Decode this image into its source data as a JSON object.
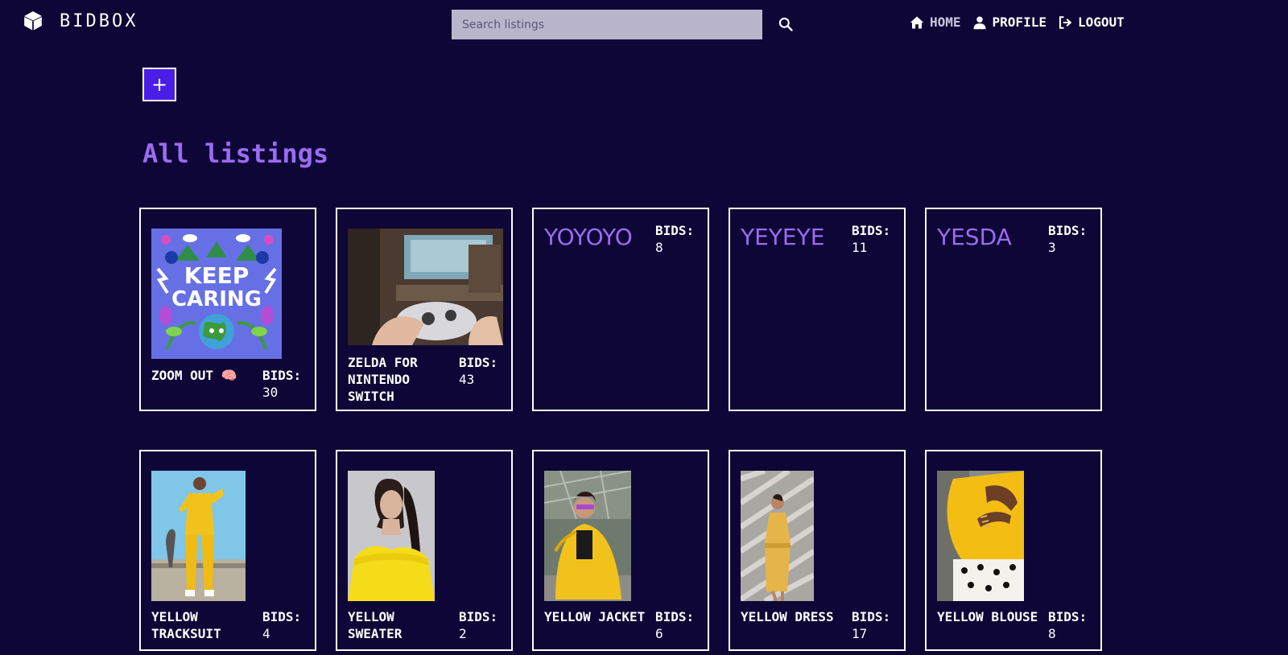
{
  "app": {
    "brand": "BIDBOX"
  },
  "search": {
    "placeholder": "Search listings"
  },
  "nav": {
    "home": "HOME",
    "profile": "PROFILE",
    "logout": "LOGOUT"
  },
  "add_button": {
    "label": "+"
  },
  "heading": "All listings",
  "listings": [
    {
      "title": "ZOOM OUT 🧠",
      "bids_label": "BIDS:",
      "bids": "30"
    },
    {
      "title": "ZELDA FOR NINTENDO SWITCH",
      "bids_label": "BIDS:",
      "bids": "43"
    },
    {
      "title": "YOYOYO",
      "bids_label": "BIDS:",
      "bids": "8"
    },
    {
      "title": "YEYEYE",
      "bids_label": "BIDS:",
      "bids": "11"
    },
    {
      "title": "YESDA",
      "bids_label": "BIDS:",
      "bids": "3"
    },
    {
      "title": "YELLOW TRACKSUIT",
      "bids_label": "BIDS:",
      "bids": "4"
    },
    {
      "title": "YELLOW SWEATER",
      "bids_label": "BIDS:",
      "bids": "2"
    },
    {
      "title": "YELLOW JACKET",
      "bids_label": "BIDS:",
      "bids": "6"
    },
    {
      "title": "YELLOW DRESS",
      "bids_label": "BIDS:",
      "bids": "17"
    },
    {
      "title": "YELLOW BLOUSE",
      "bids_label": "BIDS:",
      "bids": "8"
    }
  ],
  "poster_text": {
    "line1": "KEEP",
    "line2": "CARING"
  },
  "colors": {
    "background": "#0e0636",
    "accent": "#9b6cf2",
    "button": "#4a1ee6",
    "card_border": "#ffffff"
  },
  "icons": {
    "brand": "cube-icon",
    "search": "search-icon",
    "home": "home-icon",
    "profile": "user-icon",
    "logout": "logout-icon"
  }
}
